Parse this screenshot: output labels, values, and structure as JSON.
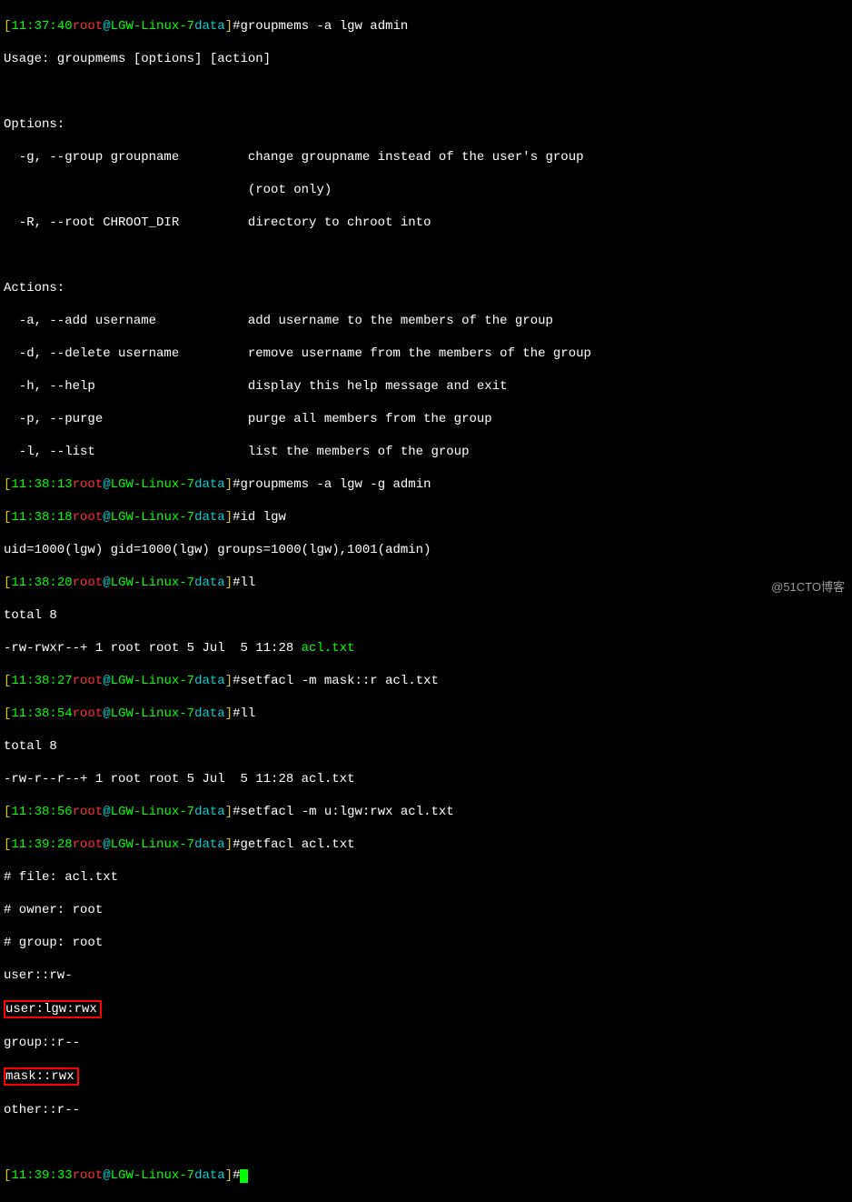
{
  "p1": {
    "time": "11:37:40",
    "user": "root",
    "at": "@",
    "host": "LGW-Linux-7",
    "dir": "data",
    "cmd": "#groupmems -a lgw admin"
  },
  "usage": "Usage: groupmems [options] [action]",
  "opthdr": "Options:",
  "opt_g": "  -g, --group groupname         change groupname instead of the user's group",
  "opt_g2": "                                (root only)",
  "opt_R": "  -R, --root CHROOT_DIR         directory to chroot into",
  "acthdr": "Actions:",
  "act_a": "  -a, --add username            add username to the members of the group",
  "act_d": "  -d, --delete username         remove username from the members of the group",
  "act_h": "  -h, --help                    display this help message and exit",
  "act_p": "  -p, --purge                   purge all members from the group",
  "act_l": "  -l, --list                    list the members of the group",
  "p2": {
    "time": "11:38:13",
    "cmd": "#groupmems -a lgw -g admin"
  },
  "p3": {
    "time": "11:38:18",
    "cmd": "#id lgw"
  },
  "idout": "uid=1000(lgw) gid=1000(lgw) groups=1000(lgw),1001(admin)",
  "p4": {
    "time": "11:38:20",
    "cmd": "#ll"
  },
  "total1": "total 8",
  "ls1a": "-rw-rwxr--+ 1 root root 5 Jul  5 11:28 ",
  "ls1f": "acl.txt",
  "p5": {
    "time": "11:38:27",
    "cmd": "#setfacl -m mask::r acl.txt"
  },
  "p6": {
    "time": "11:38:54",
    "cmd": "#ll"
  },
  "total2": "total 8",
  "ls2a": "-rw-r--r--+ 1 root root 5 Jul  5 11:28 ",
  "ls2f": "acl.txt",
  "p7": {
    "time": "11:38:56",
    "cmd": "#setfacl -m u:lgw:rwx acl.txt"
  },
  "p8": {
    "time": "11:39:28",
    "cmd": "#getfacl acl.txt"
  },
  "gf_file": "# file: acl.txt",
  "gf_owner": "# owner: root",
  "gf_group": "# group: root",
  "gf_user": "user::rw-",
  "gf_userlgw": "user:lgw:rwx",
  "gf_groupr": "group::r--",
  "gf_mask": "mask::rwx",
  "gf_other": "other::r--",
  "p9": {
    "time": "11:39:33"
  },
  "hash": "#",
  "lb": "[",
  "rb": "]",
  "watermark": "@51CTO博客"
}
